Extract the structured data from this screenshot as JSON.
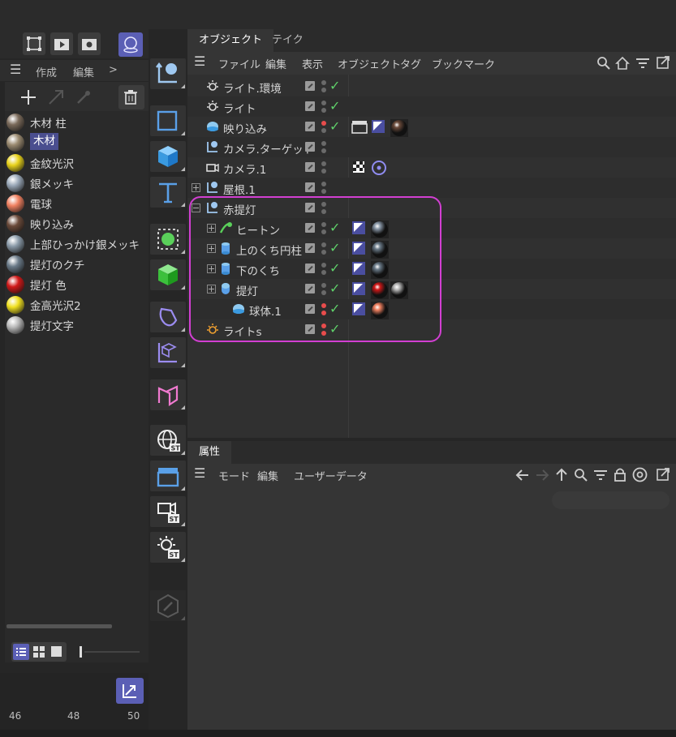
{
  "left_panel": {
    "menu": {
      "create": "作成",
      "edit": "編集",
      "more": ">"
    },
    "materials": [
      {
        "name": "木材 柱",
        "color": "#7a6a5a"
      },
      {
        "name": "木材",
        "color": "#9a8a70",
        "selected": true
      },
      {
        "name": "金紋光沢",
        "color": "#e8d21a"
      },
      {
        "name": "銀メッキ",
        "color": "#9aa8b8"
      },
      {
        "name": "電球",
        "color": "#f08060"
      },
      {
        "name": "映り込み",
        "color": "#6a4a3a"
      },
      {
        "name": "上部ひっかけ銀メッキ",
        "color": "#8a9aa8"
      },
      {
        "name": "提灯のクチ",
        "color": "#6a7a88"
      },
      {
        "name": "提灯 色",
        "color": "#d01818"
      },
      {
        "name": "金高光沢2",
        "color": "#f0e020"
      },
      {
        "name": "提灯文字",
        "color": "#b8b8b8"
      }
    ],
    "timeline_ticks": [
      "46",
      "48",
      "50"
    ]
  },
  "object_manager": {
    "tabs": [
      "オブジェクト",
      "テイク"
    ],
    "menu": [
      "ファイル",
      "編集",
      "表示",
      "オブジェクト",
      "タグ",
      "ブックマーク"
    ],
    "rows": [
      {
        "label": "ライト.環境"
      },
      {
        "label": "ライト"
      },
      {
        "label": "映り込み"
      },
      {
        "label": "カメラ.ターゲット"
      },
      {
        "label": "カメラ.1"
      },
      {
        "label": "屋根.1"
      },
      {
        "label": "赤提灯"
      },
      {
        "label": "ヒートン"
      },
      {
        "label": "上のくち円柱"
      },
      {
        "label": "下のくち"
      },
      {
        "label": "提灯"
      },
      {
        "label": "球体.1"
      },
      {
        "label": "ライトs"
      }
    ]
  },
  "attributes": {
    "tab": "属性",
    "menu": [
      "モード",
      "編集",
      "ユーザーデータ"
    ]
  },
  "colors": {
    "accent": "#5b5fb5",
    "highlight": "#d23fd2",
    "check": "#5fcf6a",
    "dot_red": "#e84c4c"
  }
}
